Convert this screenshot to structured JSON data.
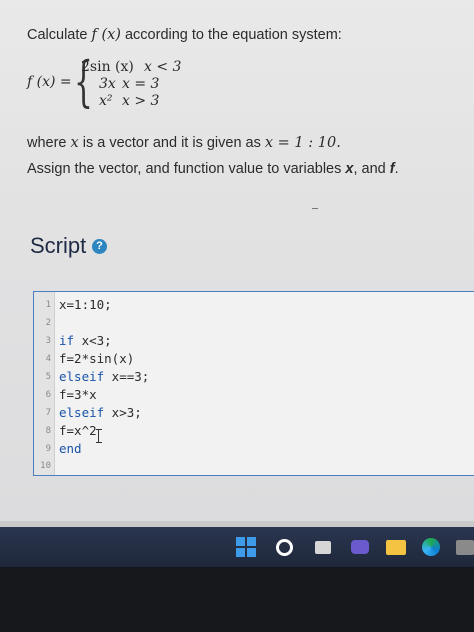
{
  "problem": {
    "intro_pre": "Calculate ",
    "intro_fx": "f (x)",
    "intro_post": " according to the equation system:",
    "lhs": "f (x) =",
    "brace": "{",
    "cases": [
      {
        "expr": "2sin (x)",
        "cond": "x < 3"
      },
      {
        "expr": "3x",
        "cond": "x = 3"
      },
      {
        "expr": "x² ",
        "cond": "x > 3"
      }
    ],
    "where_pre": "where ",
    "where_x": "x",
    "where_mid": " is a vector and it is given as ",
    "where_expr": "x = 1 : 10.",
    "assign_pre": "Assign the vector, and function value to variables ",
    "assign_x": "x",
    "assign_mid": ", and ",
    "assign_f": "f",
    "assign_end": "."
  },
  "script": {
    "title": "Script",
    "help_icon": "?",
    "lines": [
      {
        "n": "1",
        "code": "x=1:10;"
      },
      {
        "n": "2",
        "code": ""
      },
      {
        "n": "3",
        "kw": "if",
        "code": " x<3;"
      },
      {
        "n": "4",
        "code": "f=2*sin(x)"
      },
      {
        "n": "5",
        "kw": "elseif",
        "code": " x==3;"
      },
      {
        "n": "6",
        "code": "f=3*x"
      },
      {
        "n": "7",
        "kw": "elseif",
        "code": " x>3;"
      },
      {
        "n": "8",
        "code": "f=x^2"
      },
      {
        "n": "9",
        "kw": "end",
        "code": ""
      },
      {
        "n": "10",
        "code": ""
      }
    ]
  },
  "taskbar": {
    "icons": [
      "windows-start-icon",
      "search-icon",
      "task-view-icon",
      "meet-icon",
      "file-explorer-icon",
      "edge-icon",
      "store-icon"
    ]
  }
}
